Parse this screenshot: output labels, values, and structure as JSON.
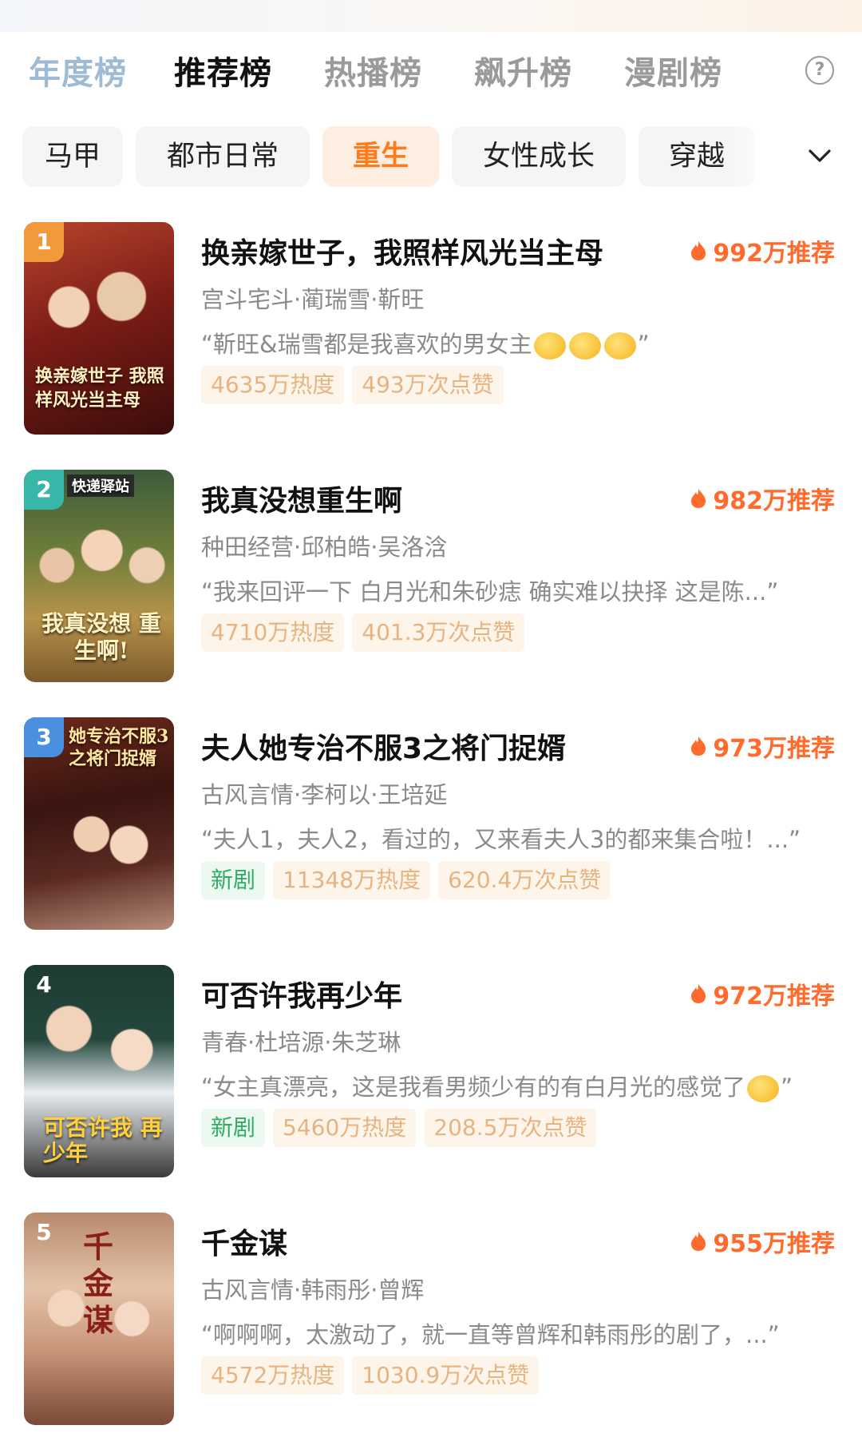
{
  "rank_tabs": [
    {
      "label": "年度榜"
    },
    {
      "label": "推荐榜"
    },
    {
      "label": "热播榜"
    },
    {
      "label": "飙升榜"
    },
    {
      "label": "漫剧榜"
    }
  ],
  "active_rank_tab": "推荐榜",
  "help_icon": "question-circle-icon",
  "genres": [
    "马甲",
    "都市日常",
    "重生",
    "女性成长",
    "穿越"
  ],
  "active_genre": "重生",
  "colors": {
    "accent": "#ff7a1a",
    "recommend": "#ff6b2c",
    "new_tag": "#2fae63",
    "tag_text": "#e6b381"
  },
  "items": [
    {
      "rank": "1",
      "title": "换亲嫁世子，我照样风光当主母",
      "recommend": "992万推荐",
      "meta": "宫斗宅斗·蔺瑞雪·靳旺",
      "quote": "“靳旺&瑞雪都是我喜欢的男女主",
      "quote_end": "”",
      "emoji": "clapping-hands-emoji",
      "tags": [
        "4635万热度",
        "493万次点赞"
      ],
      "poster_text": "换亲嫁世子 我照样风光当主母"
    },
    {
      "rank": "2",
      "title": "我真没想重生啊",
      "recommend": "982万推荐",
      "meta": "种田经营·邱柏皓·吴洛浛",
      "quote": "“我来回评一下 白月光和朱砂痣 确实难以抉择 这是陈...”",
      "tags": [
        "4710万热度",
        "401.3万次点赞"
      ],
      "poster_text": "我真没想 重生啊!",
      "poster_sign": "快递驿站"
    },
    {
      "rank": "3",
      "title": "夫人她专治不服3之将门捉婿",
      "recommend": "973万推荐",
      "meta": "古风言情·李柯以·王培延",
      "quote": "“夫人1，夫人2，看过的，又来看夫人3的都来集合啦！...”",
      "new_tag": "新剧",
      "tags": [
        "11348万热度",
        "620.4万次点赞"
      ],
      "poster_text": "她专治不服3 之将门捉婿"
    },
    {
      "rank": "4",
      "title": "可否许我再少年",
      "recommend": "972万推荐",
      "meta": "青春·杜培源·朱芝琳",
      "quote": "“女主真漂亮，这是我看男频少有的有白月光的感觉了",
      "quote_end": "”",
      "emoji": "smirk-emoji",
      "new_tag": "新剧",
      "tags": [
        "5460万热度",
        "208.5万次点赞"
      ],
      "poster_text": "可否许我 再少年"
    },
    {
      "rank": "5",
      "title": "千金谋",
      "recommend": "955万推荐",
      "meta": "古风言情·韩雨彤·曾辉",
      "quote": "“啊啊啊，太激动了，就一直等曾辉和韩雨彤的剧了，...”",
      "tags": [
        "4572万热度",
        "1030.9万次点赞"
      ],
      "poster_text": "千金谋"
    }
  ]
}
